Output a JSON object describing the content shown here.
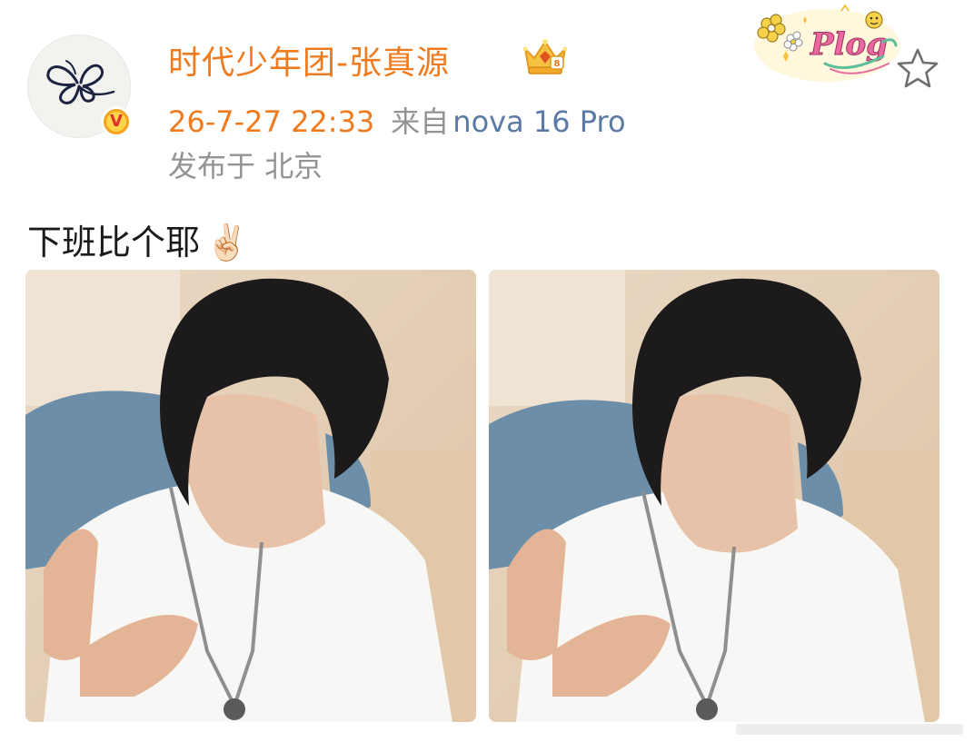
{
  "post": {
    "author_name": "时代少年团-张真源",
    "timestamp": "26-7-27 22:33",
    "source_prefix": "来自",
    "source_device": "nova 16 Pro",
    "location": "发布于 北京",
    "content": "下班比个耶",
    "content_emoji": "✌🏻",
    "verified_badge": "V"
  },
  "icons": {
    "avatar": "butterfly-avatar",
    "verified": "verified-v-badge-icon",
    "crown": "crown-badge-icon",
    "plog": "plog-sticker",
    "favorite": "star-icon"
  },
  "sticker": {
    "text": "Plog"
  },
  "colors": {
    "name": "#f07b1e",
    "timestamp": "#f07b1e",
    "meta_gray": "#939393",
    "device_link": "#5b7aa6",
    "badge_gold": "#f6a21c"
  },
  "images": [
    {
      "alt": "selfie photo 1"
    },
    {
      "alt": "selfie photo 2"
    }
  ]
}
